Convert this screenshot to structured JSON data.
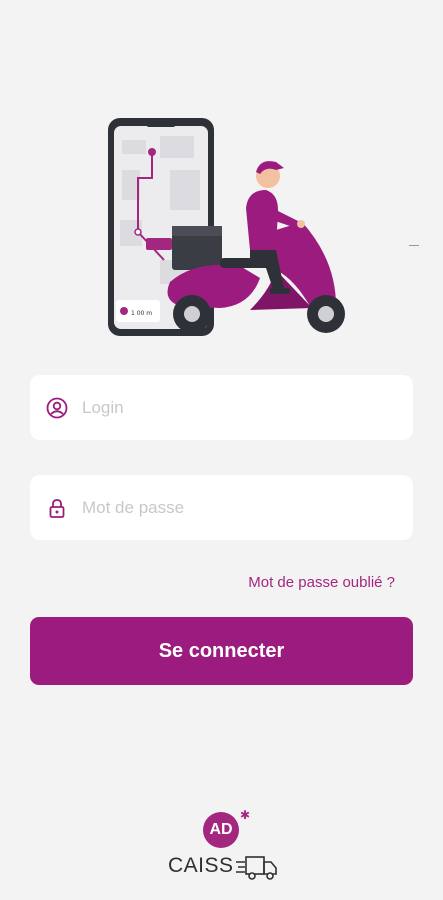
{
  "login": {
    "username_placeholder": "Login",
    "password_placeholder": "Mot de passe",
    "forgot_label": "Mot de passe oublié ?",
    "submit_label": "Se connecter"
  },
  "illustration": {
    "map_label": "1 00 m",
    "icon": "delivery-scooter-illustration"
  },
  "brand": {
    "badge": "AD",
    "name": "CAISS",
    "icon": "truck-icon"
  },
  "colors": {
    "accent": "#9b1c7e",
    "background": "#f3f3f4",
    "field": "#ffffff",
    "placeholder": "#c8c8cc"
  }
}
